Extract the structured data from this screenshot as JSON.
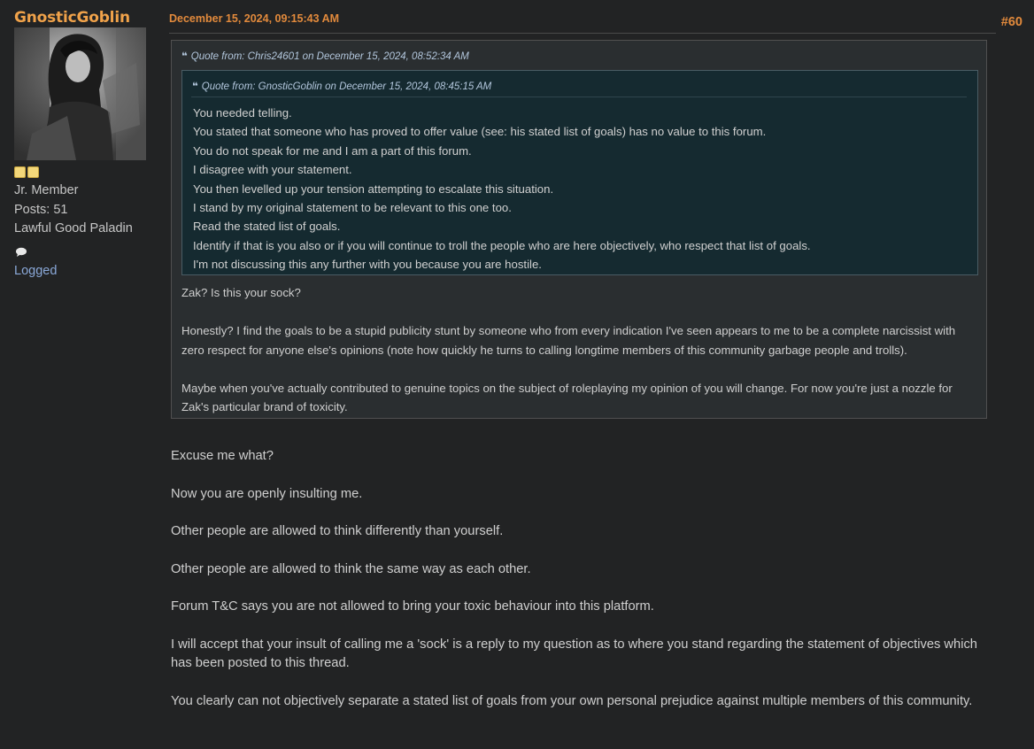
{
  "poster": {
    "username": "GnosticGoblin",
    "rank": "Jr. Member",
    "posts": "Posts: 51",
    "title": "Lawful Good Paladin",
    "logged": "Logged"
  },
  "post": {
    "date": "December 15, 2024, 09:15:43 AM",
    "number": "#60"
  },
  "quote": {
    "header": "Quote from: Chris24601 on December 15, 2024, 08:52:34 AM",
    "nested": {
      "header": "Quote from: GnosticGoblin on December 15, 2024, 08:45:15 AM",
      "lines": [
        "You needed telling.",
        "You stated that someone who has proved to offer value (see: his stated list of goals) has no value to this forum.",
        "You do not speak for me and I am a part of this forum.",
        "I disagree with your statement.",
        "You then levelled up your tension attempting to escalate this situation.",
        "I stand by my original statement to be relevant to this one too.",
        "Read the stated list of goals.",
        "Identify if that is you also or if you will continue to troll the people who are here objectively, who respect that list of goals.",
        "I'm not discussing this any further with you because you are hostile."
      ]
    },
    "paragraphs": [
      "Zak? Is this your sock?",
      "Honestly? I find the goals to be a stupid publicity stunt by someone who from every indication I've seen appears to me to be a complete narcissist with zero respect for anyone else's opinions (note how quickly he turns to calling longtime members of this community garbage people and trolls).",
      "Maybe when you've actually contributed to genuine topics on the subject of roleplaying my opinion of you will change. For now you're just a nozzle for Zak's particular brand of toxicity."
    ]
  },
  "body": {
    "paragraphs": [
      "Excuse me what?",
      "Now you are openly insulting me.",
      "Other people are allowed to think differently than yourself.",
      "Other people are allowed to think the same way as each other.",
      "Forum T&C says you are not allowed to bring your toxic behaviour into this platform.",
      "I will accept that your insult of calling me a 'sock' is a reply to my question as to where you stand regarding the statement of objectives which has been posted to this thread.",
      "You clearly can not objectively separate a stated list of goals from your own personal prejudice against multiple members of this community."
    ]
  },
  "colors": {
    "background": "#222324",
    "username": "#f0a24a",
    "date": "#e28a3c",
    "link": "#8aa8d8",
    "quote_header": "#b2c6dc",
    "nested_quote_bg": "#152a30"
  },
  "icons": {
    "stars": "star-icon",
    "im": "speech-bubble-icon",
    "quote": "quote-mark-icon"
  }
}
